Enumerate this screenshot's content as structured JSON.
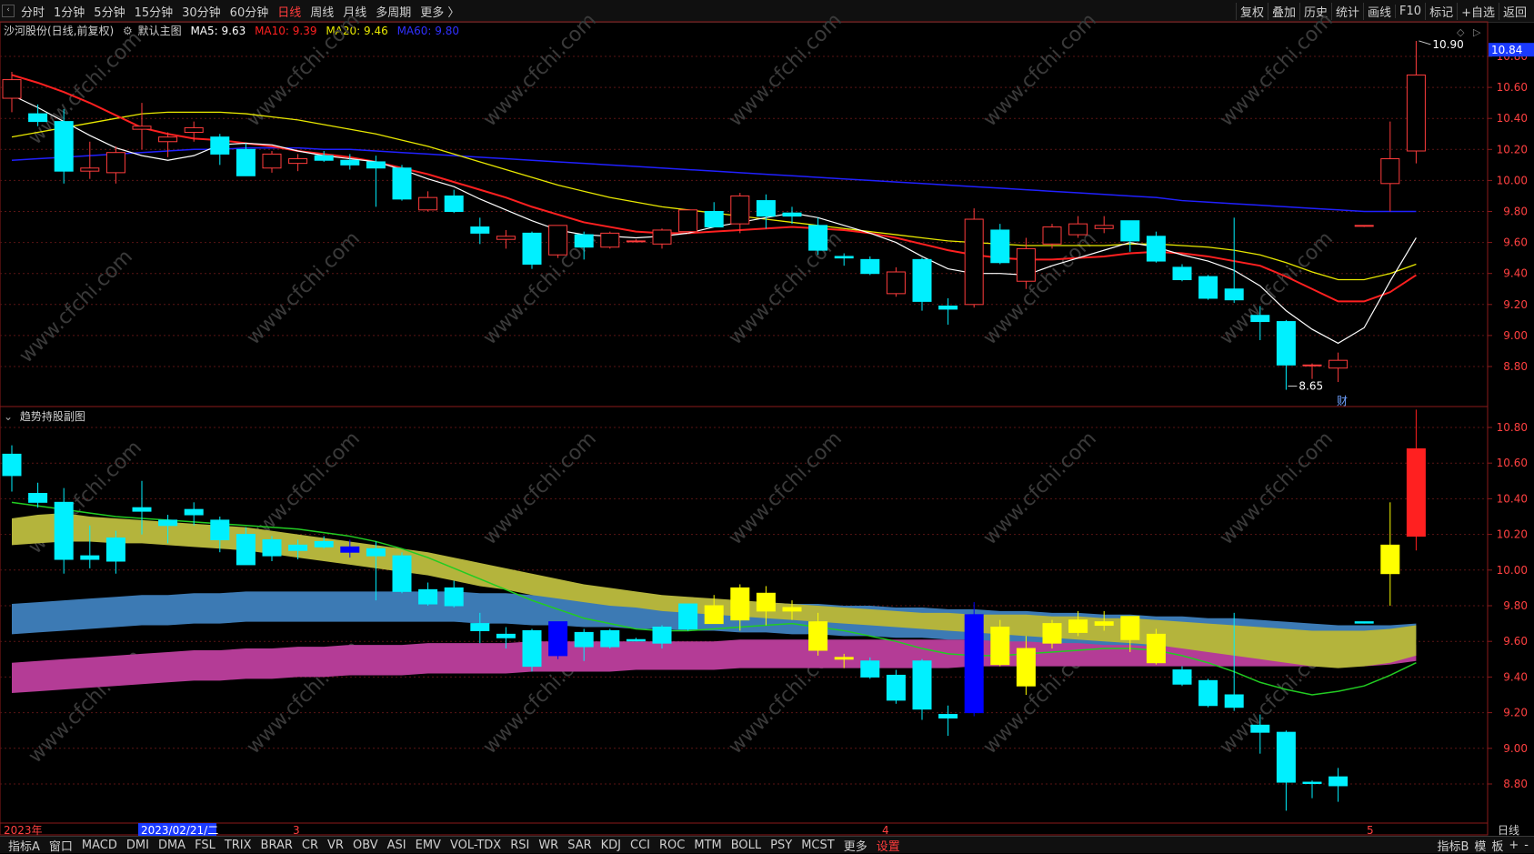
{
  "topbar": {
    "periods": [
      "分时",
      "1分钟",
      "5分钟",
      "15分钟",
      "30分钟",
      "60分钟",
      "日线",
      "周线",
      "月线",
      "多周期",
      "更多 〉"
    ],
    "active_period": "日线",
    "tools": [
      "复权",
      "叠加",
      "历史",
      "统计",
      "画线",
      "F10",
      "标记",
      "+自选",
      "返回"
    ]
  },
  "main_panel": {
    "stock": "沙河股份(日线,前复权)",
    "indicator_label": "默认主图",
    "ma5_label": "MA5: 9.63",
    "ma10_label": "MA10: 9.39",
    "ma20_label": "MA20: 9.46",
    "ma60_label": "MA60: 9.80",
    "high_label": "10.90",
    "low_label": "8.65",
    "current_price": "10.84",
    "event_mark": "财"
  },
  "sub_panel": {
    "title": "趋势持股副图"
  },
  "x_axis": {
    "year_label": "2023年",
    "cursor_date": "2023/02/21/二",
    "month_3": "3",
    "month_4": "4",
    "month_5": "5",
    "period_label": "日线"
  },
  "bottombar": {
    "tabs": [
      "指标A",
      "窗口",
      "MACD",
      "DMI",
      "DMA",
      "FSL",
      "TRIX",
      "BRAR",
      "CR",
      "VR",
      "OBV",
      "ASI",
      "EMV",
      "VOL-TDX",
      "RSI",
      "WR",
      "SAR",
      "KDJ",
      "CCI",
      "ROC",
      "MTM",
      "BOLL",
      "PSY",
      "MCST",
      "更多",
      "设置"
    ],
    "right": [
      "指标B",
      "模",
      "板",
      "+",
      "-"
    ]
  },
  "watermark": "www.cfchi.com",
  "colors": {
    "up": "#ff3c3c",
    "down": "#00f0ff",
    "ma5": "#ffffff",
    "ma10": "#ff2020",
    "ma20": "#e8e800",
    "ma60": "#2020ff",
    "band_yellow": "#b4b43c",
    "band_blue": "#3c7ab4",
    "band_magenta": "#b43c96",
    "green_line": "#22cc22"
  },
  "chart_data": {
    "type": "candlestick",
    "title": "沙河股份(日线,前复权)",
    "y_axis_ticks": [
      8.8,
      9.0,
      9.2,
      9.4,
      9.6,
      9.8,
      10.0,
      10.2,
      10.4,
      10.6,
      10.8
    ],
    "ylim": [
      8.55,
      10.92
    ],
    "candles": [
      {
        "o": 10.53,
        "h": 10.7,
        "l": 10.44,
        "c": 10.65
      },
      {
        "o": 10.43,
        "h": 10.49,
        "l": 10.35,
        "c": 10.38
      },
      {
        "o": 10.38,
        "h": 10.46,
        "l": 9.98,
        "c": 10.06
      },
      {
        "o": 10.06,
        "h": 10.25,
        "l": 10.01,
        "c": 10.08
      },
      {
        "o": 10.05,
        "h": 10.22,
        "l": 9.98,
        "c": 10.18
      },
      {
        "o": 10.33,
        "h": 10.5,
        "l": 10.2,
        "c": 10.35
      },
      {
        "o": 10.25,
        "h": 10.31,
        "l": 10.15,
        "c": 10.28
      },
      {
        "o": 10.31,
        "h": 10.38,
        "l": 10.25,
        "c": 10.34
      },
      {
        "o": 10.28,
        "h": 10.3,
        "l": 10.1,
        "c": 10.17
      },
      {
        "o": 10.2,
        "h": 10.24,
        "l": 10.03,
        "c": 10.03
      },
      {
        "o": 10.08,
        "h": 10.19,
        "l": 10.05,
        "c": 10.17
      },
      {
        "o": 10.11,
        "h": 10.17,
        "l": 10.06,
        "c": 10.14
      },
      {
        "o": 10.16,
        "h": 10.19,
        "l": 10.12,
        "c": 10.13
      },
      {
        "o": 10.13,
        "h": 10.17,
        "l": 10.07,
        "c": 10.1
      },
      {
        "o": 10.12,
        "h": 10.16,
        "l": 9.83,
        "c": 10.08
      },
      {
        "o": 10.08,
        "h": 10.1,
        "l": 9.87,
        "c": 9.88
      },
      {
        "o": 9.81,
        "h": 9.93,
        "l": 9.8,
        "c": 9.89
      },
      {
        "o": 9.9,
        "h": 9.94,
        "l": 9.79,
        "c": 9.8
      },
      {
        "o": 9.7,
        "h": 9.76,
        "l": 9.59,
        "c": 9.66
      },
      {
        "o": 9.62,
        "h": 9.68,
        "l": 9.56,
        "c": 9.64
      },
      {
        "o": 9.66,
        "h": 9.67,
        "l": 9.43,
        "c": 9.46
      },
      {
        "o": 9.52,
        "h": 9.71,
        "l": 9.5,
        "c": 9.71
      },
      {
        "o": 9.65,
        "h": 9.67,
        "l": 9.49,
        "c": 9.57
      },
      {
        "o": 9.57,
        "h": 9.67,
        "l": 9.56,
        "c": 9.66
      },
      {
        "o": 9.61,
        "h": 9.62,
        "l": 9.6,
        "c": 9.61
      },
      {
        "o": 9.59,
        "h": 9.69,
        "l": 9.56,
        "c": 9.68
      },
      {
        "o": 9.67,
        "h": 9.81,
        "l": 9.66,
        "c": 9.81
      },
      {
        "o": 9.8,
        "h": 9.86,
        "l": 9.7,
        "c": 9.7
      },
      {
        "o": 9.72,
        "h": 9.92,
        "l": 9.66,
        "c": 9.9
      },
      {
        "o": 9.87,
        "h": 9.91,
        "l": 9.69,
        "c": 9.77
      },
      {
        "o": 9.79,
        "h": 9.83,
        "l": 9.72,
        "c": 9.77
      },
      {
        "o": 9.71,
        "h": 9.76,
        "l": 9.52,
        "c": 9.55
      },
      {
        "o": 9.51,
        "h": 9.53,
        "l": 9.45,
        "c": 9.5
      },
      {
        "o": 9.49,
        "h": 9.51,
        "l": 9.39,
        "c": 9.4
      },
      {
        "o": 9.27,
        "h": 9.44,
        "l": 9.25,
        "c": 9.41
      },
      {
        "o": 9.49,
        "h": 9.5,
        "l": 9.16,
        "c": 9.22
      },
      {
        "o": 9.19,
        "h": 9.24,
        "l": 9.07,
        "c": 9.17
      },
      {
        "o": 9.2,
        "h": 9.82,
        "l": 9.18,
        "c": 9.75
      },
      {
        "o": 9.68,
        "h": 9.72,
        "l": 9.46,
        "c": 9.47
      },
      {
        "o": 9.35,
        "h": 9.63,
        "l": 9.3,
        "c": 9.56
      },
      {
        "o": 9.59,
        "h": 9.72,
        "l": 9.56,
        "c": 9.7
      },
      {
        "o": 9.65,
        "h": 9.77,
        "l": 9.63,
        "c": 9.72
      },
      {
        "o": 9.69,
        "h": 9.77,
        "l": 9.66,
        "c": 9.71
      },
      {
        "o": 9.74,
        "h": 9.74,
        "l": 9.54,
        "c": 9.61
      },
      {
        "o": 9.64,
        "h": 9.67,
        "l": 9.47,
        "c": 9.48
      },
      {
        "o": 9.44,
        "h": 9.46,
        "l": 9.35,
        "c": 9.36
      },
      {
        "o": 9.38,
        "h": 9.39,
        "l": 9.23,
        "c": 9.24
      },
      {
        "o": 9.3,
        "h": 9.76,
        "l": 9.21,
        "c": 9.23
      },
      {
        "o": 9.13,
        "h": 9.19,
        "l": 8.97,
        "c": 9.09
      },
      {
        "o": 9.09,
        "h": 9.1,
        "l": 8.65,
        "c": 8.81
      },
      {
        "o": 8.81,
        "h": 8.82,
        "l": 8.72,
        "c": 8.81
      },
      {
        "o": 8.79,
        "h": 8.89,
        "l": 8.7,
        "c": 8.84
      },
      {
        "o": 9.71,
        "h": 9.71,
        "l": 9.7,
        "c": 9.71
      },
      {
        "o": 9.98,
        "h": 10.38,
        "l": 9.8,
        "c": 10.14
      },
      {
        "o": 10.19,
        "h": 10.9,
        "l": 10.11,
        "c": 10.68
      }
    ],
    "ma5": [
      10.55,
      10.47,
      10.38,
      10.29,
      10.21,
      10.16,
      10.13,
      10.16,
      10.23,
      10.24,
      10.23,
      10.19,
      10.16,
      10.14,
      10.12,
      10.07,
      10.01,
      9.96,
      9.88,
      9.81,
      9.74,
      9.68,
      9.65,
      9.64,
      9.63,
      9.64,
      9.66,
      9.7,
      9.73,
      9.76,
      9.79,
      9.76,
      9.71,
      9.66,
      9.6,
      9.51,
      9.43,
      9.4,
      9.4,
      9.39,
      9.45,
      9.5,
      9.55,
      9.6,
      9.57,
      9.52,
      9.48,
      9.42,
      9.32,
      9.16,
      9.04,
      8.95,
      9.05,
      9.35,
      9.63
    ],
    "ma10": [
      10.68,
      10.63,
      10.57,
      10.5,
      10.42,
      10.34,
      10.3,
      10.27,
      10.26,
      10.24,
      10.22,
      10.19,
      10.17,
      10.15,
      10.12,
      10.08,
      10.04,
      9.99,
      9.94,
      9.89,
      9.83,
      9.78,
      9.73,
      9.7,
      9.67,
      9.66,
      9.66,
      9.67,
      9.68,
      9.69,
      9.7,
      9.69,
      9.68,
      9.66,
      9.63,
      9.59,
      9.55,
      9.52,
      9.5,
      9.49,
      9.49,
      9.5,
      9.51,
      9.53,
      9.54,
      9.53,
      9.51,
      9.48,
      9.45,
      9.38,
      9.3,
      9.22,
      9.22,
      9.28,
      9.39
    ],
    "ma20": [
      10.28,
      10.31,
      10.34,
      10.37,
      10.4,
      10.43,
      10.44,
      10.44,
      10.44,
      10.43,
      10.41,
      10.39,
      10.36,
      10.33,
      10.3,
      10.26,
      10.22,
      10.17,
      10.12,
      10.07,
      10.02,
      9.97,
      9.93,
      9.89,
      9.86,
      9.83,
      9.81,
      9.79,
      9.77,
      9.75,
      9.73,
      9.71,
      9.69,
      9.67,
      9.65,
      9.63,
      9.61,
      9.6,
      9.59,
      9.58,
      9.58,
      9.58,
      9.58,
      9.59,
      9.59,
      9.58,
      9.57,
      9.55,
      9.52,
      9.47,
      9.41,
      9.36,
      9.36,
      9.4,
      9.46
    ],
    "ma60": [
      10.13,
      10.14,
      10.15,
      10.16,
      10.17,
      10.18,
      10.19,
      10.2,
      10.2,
      10.21,
      10.21,
      10.21,
      10.2,
      10.2,
      10.19,
      10.18,
      10.17,
      10.16,
      10.15,
      10.14,
      10.13,
      10.12,
      10.11,
      10.1,
      10.09,
      10.08,
      10.07,
      10.06,
      10.05,
      10.04,
      10.03,
      10.02,
      10.01,
      10.0,
      9.99,
      9.98,
      9.97,
      9.96,
      9.95,
      9.94,
      9.93,
      9.92,
      9.91,
      9.9,
      9.89,
      9.87,
      9.86,
      9.85,
      9.84,
      9.83,
      9.82,
      9.81,
      9.8,
      9.8,
      9.8
    ],
    "sub_green_line": [
      10.38,
      10.36,
      10.34,
      10.32,
      10.3,
      10.29,
      10.28,
      10.27,
      10.26,
      10.25,
      10.24,
      10.23,
      10.21,
      10.19,
      10.16,
      10.12,
      10.07,
      10.01,
      9.95,
      9.89,
      9.83,
      9.78,
      9.73,
      9.7,
      9.67,
      9.66,
      9.66,
      9.67,
      9.68,
      9.69,
      9.7,
      9.68,
      9.66,
      9.63,
      9.6,
      9.56,
      9.53,
      9.52,
      9.52,
      9.53,
      9.54,
      9.55,
      9.56,
      9.56,
      9.55,
      9.52,
      9.48,
      9.43,
      9.37,
      9.33,
      9.3,
      9.32,
      9.35,
      9.41,
      9.48
    ],
    "sub_band_yellow": {
      "upper": [
        10.29,
        10.31,
        10.32,
        10.3,
        10.29,
        10.28,
        10.27,
        10.26,
        10.25,
        10.24,
        10.22,
        10.2,
        10.18,
        10.16,
        10.14,
        10.12,
        10.1,
        10.07,
        10.04,
        10.01,
        9.98,
        9.95,
        9.92,
        9.9,
        9.88,
        9.86,
        9.85,
        9.84,
        9.83,
        9.82,
        9.81,
        9.8,
        9.79,
        9.78,
        9.77,
        9.76,
        9.76,
        9.75,
        9.75,
        9.75,
        9.74,
        9.74,
        9.73,
        9.73,
        9.72,
        9.71,
        9.7,
        9.69,
        9.68,
        9.67,
        9.66,
        9.66,
        9.66,
        9.67,
        9.69
      ],
      "lower": [
        10.14,
        10.15,
        10.16,
        10.16,
        10.15,
        10.15,
        10.14,
        10.13,
        10.12,
        10.11,
        10.09,
        10.07,
        10.05,
        10.03,
        10.01,
        9.99,
        9.97,
        9.94,
        9.91,
        9.89,
        9.86,
        9.84,
        9.82,
        9.8,
        9.79,
        9.77,
        9.76,
        9.75,
        9.74,
        9.73,
        9.72,
        9.71,
        9.7,
        9.69,
        9.68,
        9.67,
        9.66,
        9.65,
        9.64,
        9.63,
        9.62,
        9.61,
        9.6,
        9.59,
        9.58,
        9.56,
        9.54,
        9.52,
        9.5,
        9.48,
        9.46,
        9.45,
        9.46,
        9.48,
        9.52
      ]
    },
    "sub_band_blue": {
      "upper": [
        9.81,
        9.82,
        9.83,
        9.84,
        9.85,
        9.86,
        9.86,
        9.87,
        9.87,
        9.88,
        9.88,
        9.88,
        9.88,
        9.88,
        9.88,
        9.88,
        9.88,
        9.88,
        9.87,
        9.87,
        9.86,
        9.86,
        9.85,
        9.85,
        9.84,
        9.84,
        9.83,
        9.83,
        9.82,
        9.82,
        9.81,
        9.81,
        9.8,
        9.8,
        9.79,
        9.79,
        9.78,
        9.78,
        9.77,
        9.77,
        9.76,
        9.76,
        9.75,
        9.75,
        9.74,
        9.74,
        9.73,
        9.73,
        9.72,
        9.71,
        9.7,
        9.69,
        9.69,
        9.69,
        9.7
      ],
      "lower": [
        9.64,
        9.65,
        9.66,
        9.67,
        9.68,
        9.69,
        9.69,
        9.7,
        9.7,
        9.71,
        9.71,
        9.71,
        9.71,
        9.71,
        9.71,
        9.71,
        9.71,
        9.71,
        9.7,
        9.7,
        9.69,
        9.69,
        9.68,
        9.68,
        9.67,
        9.67,
        9.66,
        9.66,
        9.65,
        9.65,
        9.64,
        9.64,
        9.63,
        9.63,
        9.62,
        9.62,
        9.61,
        9.61,
        9.6,
        9.6,
        9.59,
        9.59,
        9.58,
        9.58,
        9.57,
        9.57,
        9.56,
        9.56,
        9.55,
        9.54,
        9.54,
        9.54,
        9.55,
        9.57,
        9.61
      ]
    },
    "sub_band_magenta": {
      "upper": [
        9.48,
        9.49,
        9.5,
        9.51,
        9.52,
        9.53,
        9.54,
        9.55,
        9.55,
        9.56,
        9.56,
        9.57,
        9.57,
        9.58,
        9.58,
        9.58,
        9.59,
        9.59,
        9.59,
        9.59,
        9.6,
        9.6,
        9.6,
        9.6,
        9.6,
        9.6,
        9.6,
        9.6,
        9.61,
        9.61,
        9.61,
        9.61,
        9.61,
        9.61,
        9.61,
        9.61,
        9.61,
        9.61,
        9.61,
        9.61,
        9.61,
        9.6,
        9.6,
        9.6,
        9.6,
        9.59,
        9.59,
        9.58,
        9.57,
        9.56,
        9.55,
        9.54,
        9.54,
        9.55,
        9.58
      ],
      "lower": [
        9.31,
        9.32,
        9.33,
        9.34,
        9.35,
        9.36,
        9.37,
        9.38,
        9.38,
        9.39,
        9.39,
        9.4,
        9.4,
        9.41,
        9.41,
        9.41,
        9.42,
        9.42,
        9.42,
        9.42,
        9.43,
        9.43,
        9.43,
        9.43,
        9.44,
        9.44,
        9.44,
        9.44,
        9.45,
        9.45,
        9.45,
        9.45,
        9.45,
        9.45,
        9.45,
        9.45,
        9.45,
        9.46,
        9.46,
        9.46,
        9.46,
        9.46,
        9.46,
        9.46,
        9.46,
        9.46,
        9.46,
        9.46,
        9.46,
        9.46,
        9.46,
        9.46,
        9.46,
        9.47,
        9.49
      ]
    },
    "sub_candle_colors": [
      "cyan",
      "cyan",
      "cyan",
      "cyan",
      "cyan",
      "cyan",
      "cyan",
      "cyan",
      "cyan",
      "cyan",
      "cyan",
      "cyan",
      "cyan",
      "blue",
      "cyan",
      "cyan",
      "cyan",
      "cyan",
      "cyan",
      "cyan",
      "cyan",
      "blue",
      "cyan",
      "cyan",
      "cyan",
      "cyan",
      "cyan",
      "yellow",
      "yellow",
      "yellow",
      "yellow",
      "yellow",
      "yellow",
      "cyan",
      "cyan",
      "cyan",
      "cyan",
      "blue",
      "yellow",
      "yellow",
      "yellow",
      "yellow",
      "yellow",
      "yellow",
      "yellow",
      "cyan",
      "cyan",
      "cyan",
      "cyan",
      "cyan",
      "cyan",
      "cyan",
      "cyan",
      "yellow",
      "red"
    ]
  }
}
